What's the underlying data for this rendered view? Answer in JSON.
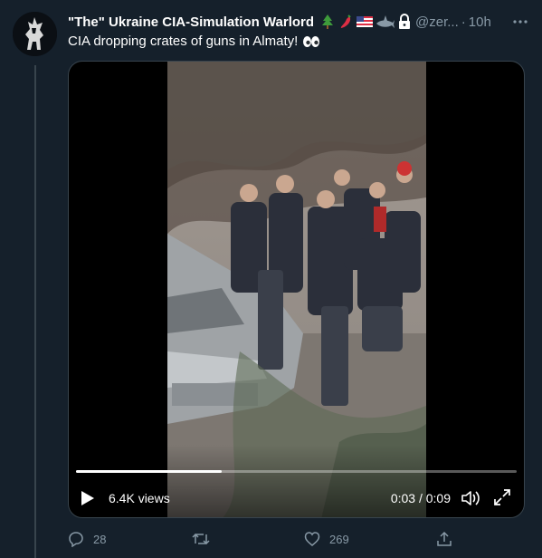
{
  "tweet": {
    "display_name": "\"The\" Ukraine CIA-Simulation Warlord",
    "handle": "@zer...",
    "separator": "·",
    "time": "10h",
    "text": "CIA dropping crates of guns in Almaty!",
    "name_emojis": [
      "christmas-tree-icon",
      "chili-pepper-icon",
      "us-flag-icon",
      "shark-icon",
      "lock-icon"
    ],
    "text_emoji": "eyes-icon"
  },
  "video": {
    "views": "6.4K views",
    "timecode": "0:03 / 0:09",
    "progress": 0.33
  },
  "actions": {
    "replies": "28",
    "retweets": "",
    "likes": "269"
  },
  "colors": {
    "background": "#15202b",
    "border": "#38444d",
    "secondary_text": "#8899a6",
    "primary_text": "#ffffff"
  }
}
